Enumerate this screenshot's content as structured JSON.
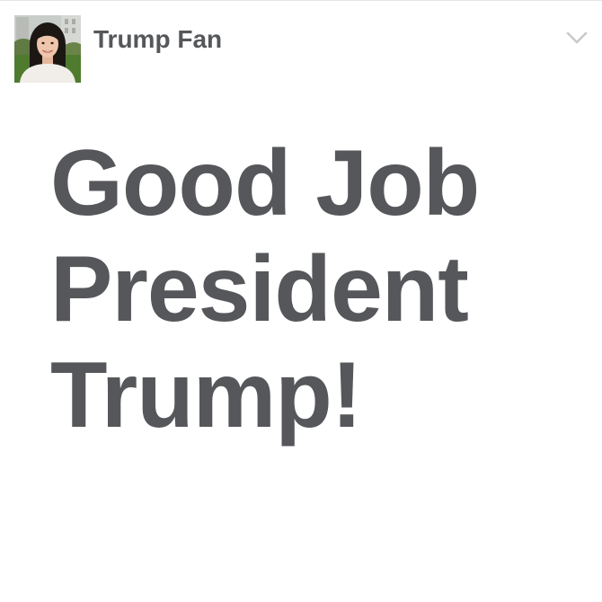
{
  "post": {
    "author": {
      "name": "Trump Fan",
      "avatar_icon": "profile-photo"
    },
    "menu_icon": "chevron-down-icon",
    "text_lines": [
      "Good Job",
      "President",
      "Trump!"
    ]
  },
  "colors": {
    "text": "#55575a",
    "chevron": "#c8c9cc",
    "background": "#ffffff",
    "divider": "#e6e6e6"
  }
}
